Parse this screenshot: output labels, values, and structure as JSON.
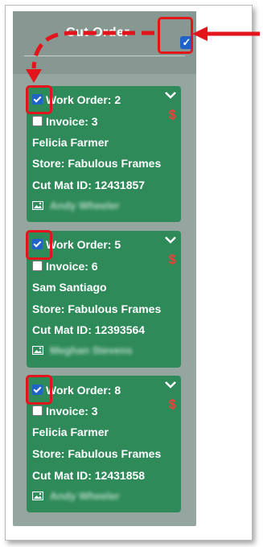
{
  "header": {
    "title": "Cut Order",
    "select_all_checked": true
  },
  "cards": [
    {
      "work_order": "Work Order: 2",
      "invoice": "Invoice: 3",
      "customer": "Felicia Farmer",
      "store": "Store: Fabulous Frames",
      "cut_mat_id": "Cut Mat ID: 12431857",
      "assignee": "Andy Wheeler",
      "selected": true,
      "invoice_checked": false
    },
    {
      "work_order": "Work Order: 5",
      "invoice": "Invoice: 6",
      "customer": "Sam Santiago",
      "store": "Store: Fabulous Frames",
      "cut_mat_id": "Cut Mat ID: 12393564",
      "assignee": "Meghan Stevens",
      "selected": true,
      "invoice_checked": false
    },
    {
      "work_order": "Work Order: 8",
      "invoice": "Invoice: 3",
      "customer": "Felicia Farmer",
      "store": "Store: Fabulous Frames",
      "cut_mat_id": "Cut Mat ID: 12431858",
      "assignee": "Andy Wheeler",
      "selected": true,
      "invoice_checked": false
    }
  ],
  "icons": {
    "expand": "chevron-down-icon",
    "price": "dollar-icon",
    "image": "image-icon",
    "checkbox": "checkbox-icon"
  },
  "colors": {
    "card": "#2e8a59",
    "panel": "#95a59f",
    "header": "#879892",
    "callout": "#e3151a",
    "dollar": "#e2463a",
    "checkbox": "#1f63c8"
  }
}
